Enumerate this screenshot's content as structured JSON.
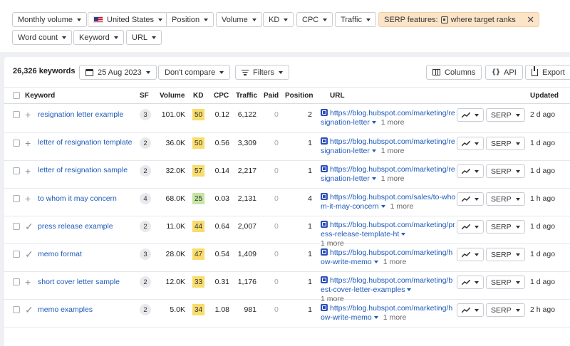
{
  "colors": {
    "accent": "#1d5ab8",
    "kd_yellow": "#f8dc6c",
    "kd_green": "#c6e5a2",
    "serp_chip": "#fbe4c8"
  },
  "filters": {
    "row1": [
      "Monthly volume",
      "United States",
      "Position",
      "Volume",
      "KD",
      "CPC",
      "Traffic"
    ],
    "serp_chip": {
      "prefix": "SERP features:",
      "value": "where target ranks",
      "close": "✕"
    },
    "row2": [
      "Word count",
      "Keyword",
      "URL"
    ]
  },
  "toolbar": {
    "count": "26,326 keywords",
    "date": "25 Aug 2023",
    "compare": "Don't compare",
    "filters": "Filters",
    "columns": "Columns",
    "api": "API",
    "export": "Export"
  },
  "columns": [
    "Keyword",
    "SF",
    "Volume",
    "KD",
    "CPC",
    "Traffic",
    "Paid",
    "Position",
    "URL",
    "Updated"
  ],
  "row_actions": {
    "trend_icon": "trend-icon",
    "serp_label": "SERP"
  },
  "rows": [
    {
      "icon": "+",
      "keyword": "resignation letter example",
      "sf": "3",
      "volume": "101.0K",
      "kd": "50",
      "kd_color": "#f8dc6c",
      "cpc": "0.12",
      "traffic": "6,122",
      "paid": "0",
      "position": "2",
      "url": "https://blog.hubspot.com/marketing/resignation-letter",
      "more": "1 more",
      "updated": "2 d ago"
    },
    {
      "icon": "+",
      "keyword": "letter of resignation template",
      "sf": "2",
      "volume": "36.0K",
      "kd": "50",
      "kd_color": "#f8dc6c",
      "cpc": "0.56",
      "traffic": "3,309",
      "paid": "0",
      "position": "1",
      "url": "https://blog.hubspot.com/marketing/resignation-letter",
      "more": "1 more",
      "updated": "1 d ago"
    },
    {
      "icon": "+",
      "keyword": "letter of resignation sample",
      "sf": "2",
      "volume": "32.0K",
      "kd": "57",
      "kd_color": "#f8dc6c",
      "cpc": "0.14",
      "traffic": "2,217",
      "paid": "0",
      "position": "1",
      "url": "https://blog.hubspot.com/marketing/resignation-letter",
      "more": "1 more",
      "updated": "1 d ago"
    },
    {
      "icon": "+",
      "keyword": "to whom it may concern",
      "sf": "4",
      "volume": "68.0K",
      "kd": "25",
      "kd_color": "#c6e5a2",
      "cpc": "0.03",
      "traffic": "2,131",
      "paid": "0",
      "position": "4",
      "url": "https://blog.hubspot.com/sales/to-whom-it-may-concern",
      "more": "1 more",
      "updated": "1 h ago"
    },
    {
      "icon": "✓",
      "keyword": "press release example",
      "sf": "2",
      "volume": "11.0K",
      "kd": "44",
      "kd_color": "#f8dc6c",
      "cpc": "0.64",
      "traffic": "2,007",
      "paid": "0",
      "position": "1",
      "url": "https://blog.hubspot.com/marketing/press-release-template-ht",
      "more": "1 more",
      "updated": "1 d ago"
    },
    {
      "icon": "✓",
      "keyword": "memo format",
      "sf": "3",
      "volume": "28.0K",
      "kd": "47",
      "kd_color": "#f8dc6c",
      "cpc": "0.54",
      "traffic": "1,409",
      "paid": "0",
      "position": "1",
      "url": "https://blog.hubspot.com/marketing/how-write-memo",
      "more": "1 more",
      "updated": "1 d ago"
    },
    {
      "icon": "+",
      "keyword": "short cover letter sample",
      "sf": "2",
      "volume": "12.0K",
      "kd": "33",
      "kd_color": "#f8dc6c",
      "cpc": "0.31",
      "traffic": "1,176",
      "paid": "0",
      "position": "1",
      "url": "https://blog.hubspot.com/marketing/best-cover-letter-examples",
      "more": "1 more",
      "updated": "1 d ago"
    },
    {
      "icon": "✓",
      "keyword": "memo examples",
      "sf": "2",
      "volume": "5.0K",
      "kd": "34",
      "kd_color": "#f8dc6c",
      "cpc": "1.08",
      "traffic": "981",
      "paid": "0",
      "position": "1",
      "url": "https://blog.hubspot.com/marketing/how-write-memo",
      "more": "1 more",
      "updated": "2 h ago"
    }
  ]
}
